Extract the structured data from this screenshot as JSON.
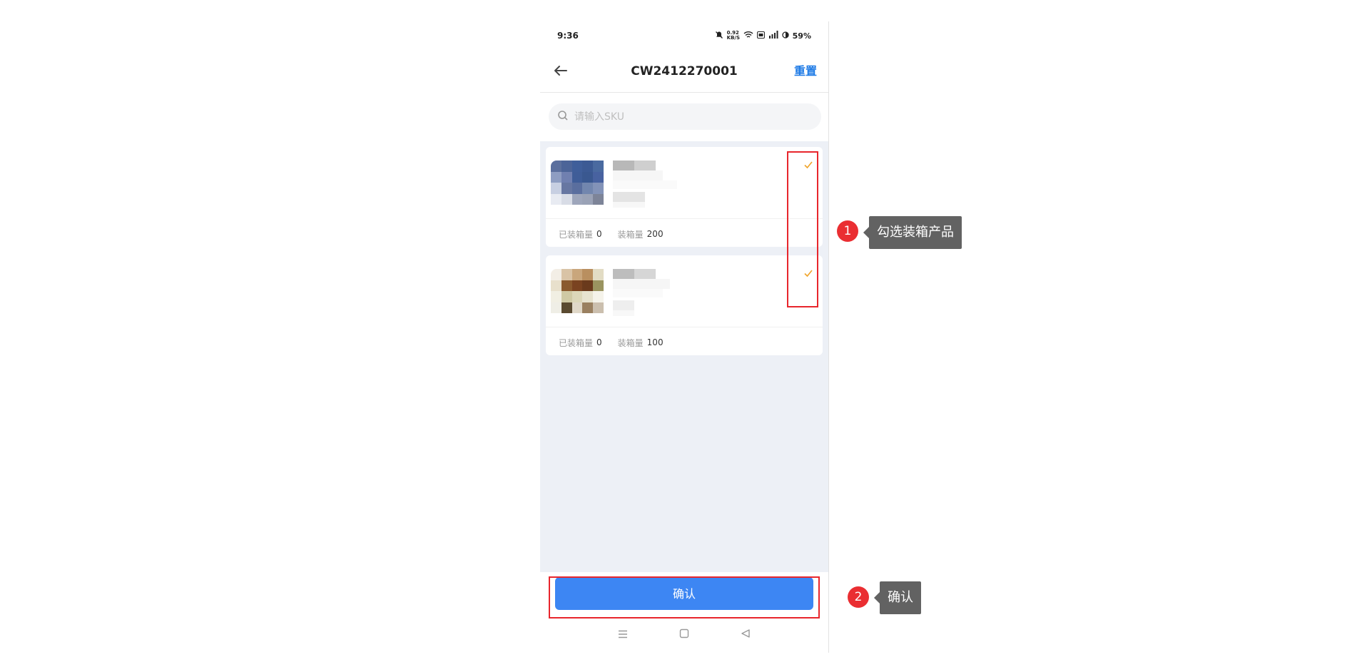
{
  "status_bar": {
    "time": "9:36",
    "mute_icon": "bell-off-icon",
    "net_speed": "0.92 KB/S",
    "battery": "59%"
  },
  "nav": {
    "back_icon": "arrow-left-icon",
    "title": "CW2412270001",
    "reset_label": "重置"
  },
  "search": {
    "placeholder": "请输入SKU",
    "value": ""
  },
  "products": [
    {
      "packed_label": "已装箱量",
      "packed_value": "0",
      "pack_qty_label": "装箱量",
      "pack_qty_value": "200",
      "checked": true,
      "check_icon": "checkmark-icon"
    },
    {
      "packed_label": "已装箱量",
      "packed_value": "0",
      "pack_qty_label": "装箱量",
      "pack_qty_value": "100",
      "checked": true,
      "check_icon": "checkmark-icon"
    }
  ],
  "confirm_label": "确认",
  "system_nav": {
    "menu_icon": "menu-icon",
    "home_icon": "square-home-icon",
    "back_icon": "triangle-back-icon"
  },
  "annotations": [
    {
      "number": "1",
      "text": "勾选装箱产品"
    },
    {
      "number": "2",
      "text": "确认"
    }
  ],
  "colors": {
    "accent": "#3d86f3",
    "reset_link": "#1e7be6",
    "check": "#f0a42a",
    "highlight": "#e8262c",
    "list_bg": "#edf0f6",
    "tooltip_bg": "#626262"
  }
}
